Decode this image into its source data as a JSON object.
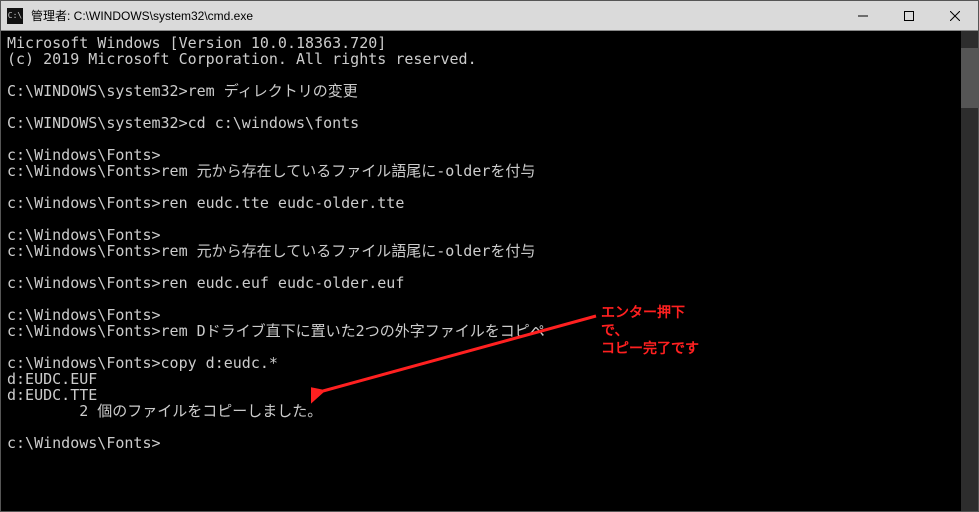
{
  "window": {
    "title": "管理者: C:\\WINDOWS\\system32\\cmd.exe"
  },
  "terminal": {
    "lines": [
      "Microsoft Windows [Version 10.0.18363.720]",
      "(c) 2019 Microsoft Corporation. All rights reserved.",
      "",
      "C:\\WINDOWS\\system32>rem ディレクトリの変更",
      "",
      "C:\\WINDOWS\\system32>cd c:\\windows\\fonts",
      "",
      "c:\\Windows\\Fonts>",
      "c:\\Windows\\Fonts>rem 元から存在しているファイル語尾に-olderを付与",
      "",
      "c:\\Windows\\Fonts>ren eudc.tte eudc-older.tte",
      "",
      "c:\\Windows\\Fonts>",
      "c:\\Windows\\Fonts>rem 元から存在しているファイル語尾に-olderを付与",
      "",
      "c:\\Windows\\Fonts>ren eudc.euf eudc-older.euf",
      "",
      "c:\\Windows\\Fonts>",
      "c:\\Windows\\Fonts>rem Dドライブ直下に置いた2つの外字ファイルをコピペ",
      "",
      "c:\\Windows\\Fonts>copy d:eudc.*",
      "d:EUDC.EUF",
      "d:EUDC.TTE",
      "        2 個のファイルをコピーしました。",
      "",
      "c:\\Windows\\Fonts>"
    ]
  },
  "annotation": {
    "text": "エンター押下\nで、\nコピー完了です"
  }
}
